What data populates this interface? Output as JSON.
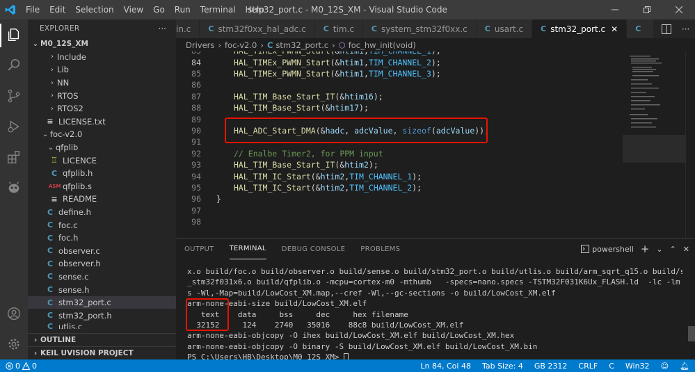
{
  "window": {
    "title": "stm32_port.c - M0_12S_XM - Visual Studio Code",
    "menu": [
      "File",
      "Edit",
      "Selection",
      "View",
      "Go",
      "Run",
      "Terminal",
      "Help"
    ]
  },
  "sidebar": {
    "title": "EXPLORER",
    "more": "···",
    "root": "M0_12S_XM",
    "items": [
      {
        "label": "Include",
        "kind": "folder"
      },
      {
        "label": "Lib",
        "kind": "folder"
      },
      {
        "label": "NN",
        "kind": "folder"
      },
      {
        "label": "RTOS",
        "kind": "folder"
      },
      {
        "label": "RTOS2",
        "kind": "folder"
      },
      {
        "label": "LICENSE.txt",
        "kind": "txt"
      },
      {
        "label": "foc-v2.0",
        "kind": "folder-open"
      },
      {
        "label": "qfplib",
        "kind": "folder-open"
      },
      {
        "label": "LICENCE",
        "kind": "licence"
      },
      {
        "label": "qfplib.h",
        "kind": "c"
      },
      {
        "label": "qfplib.s",
        "kind": "asm"
      },
      {
        "label": "README",
        "kind": "txt"
      },
      {
        "label": "define.h",
        "kind": "c"
      },
      {
        "label": "foc.c",
        "kind": "c"
      },
      {
        "label": "foc.h",
        "kind": "c"
      },
      {
        "label": "observer.c",
        "kind": "c"
      },
      {
        "label": "observer.h",
        "kind": "c"
      },
      {
        "label": "sense.c",
        "kind": "c"
      },
      {
        "label": "sense.h",
        "kind": "c"
      },
      {
        "label": "stm32_port.c",
        "kind": "c"
      },
      {
        "label": "stm32_port.h",
        "kind": "c"
      },
      {
        "label": "utlis.c",
        "kind": "c"
      }
    ],
    "outline": "OUTLINE",
    "keil": "KEIL UVISION PROJECT"
  },
  "tabs": [
    {
      "label": "in.c",
      "active": false
    },
    {
      "label": "stm32f0xx_hal_adc.c",
      "active": false
    },
    {
      "label": "tim.c",
      "active": false
    },
    {
      "label": "system_stm32f0xx.c",
      "active": false
    },
    {
      "label": "usart.c",
      "active": false
    },
    {
      "label": "stm32_port.c",
      "active": true
    },
    {
      "label": "",
      "active": false
    }
  ],
  "breadcrumb": [
    "Drivers",
    "foc-v2.0",
    "stm32_port.c",
    "foc_hw_init(void)"
  ],
  "editor": {
    "current_line": "84",
    "lines": [
      {
        "n": "83",
        "code": "HAL_TIMEx_PWMN_Start(&htim1,TIM_CHANNEL_1);"
      },
      {
        "n": "84",
        "code": "HAL_TIMEx_PWMN_Start(&htim1,TIM_CHANNEL_2);"
      },
      {
        "n": "85",
        "code": "HAL_TIMEx_PWMN_Start(&htim1,TIM_CHANNEL_3);"
      },
      {
        "n": "86",
        "code": ""
      },
      {
        "n": "87",
        "code": "HAL_TIM_Base_Start_IT(&htim16);"
      },
      {
        "n": "88",
        "code": "HAL_TIM_Base_Start(&htim17);"
      },
      {
        "n": "89",
        "code": ""
      },
      {
        "n": "90",
        "code": "HAL_ADC_Start_DMA(&hadc, adcValue, sizeof(adcValue));"
      },
      {
        "n": "91",
        "code": ""
      },
      {
        "n": "92",
        "code": "// Enalbe Timer2, for PPM input"
      },
      {
        "n": "93",
        "code": "HAL_TIM_Base_Start_IT(&htim2);"
      },
      {
        "n": "94",
        "code": "HAL_TIM_IC_Start(&htim2,TIM_CHANNEL_1);"
      },
      {
        "n": "95",
        "code": "HAL_TIM_IC_Start(&htim2,TIM_CHANNEL_2);"
      },
      {
        "n": "96",
        "code": "}"
      },
      {
        "n": "97",
        "code": ""
      },
      {
        "n": "98",
        "code": ""
      }
    ]
  },
  "panel": {
    "tabs": [
      "OUTPUT",
      "TERMINAL",
      "DEBUG CONSOLE",
      "PROBLEMS"
    ],
    "active_tab": "TERMINAL",
    "shell": "powershell",
    "terminal_lines": [
      "x.o build/foc.o build/observer.o build/sense.o build/stm32_port.o build/utlis.o build/arm_sqrt_q15.o build/startup",
      "_stm32f031x6.o build/qfplib.o -mcpu=cortex-m0 -mthumb   -specs=nano.specs -TSTM32F031K6Ux_FLASH.ld  -lc -lm -lnosy",
      "s -Wl,-Map=build/LowCost_XM.map,--cref -Wl,--gc-sections -o build/LowCost_XM.elf",
      "arm-none-eabi-size build/LowCost_XM.elf",
      "   text    data     bss     dec     hex filename",
      "  32152     124    2740   35016    88c8 build/LowCost_XM.elf",
      "arm-none-eabi-objcopy -O ihex build/LowCost_XM.elf build/LowCost_XM.hex",
      "arm-none-eabi-objcopy -O binary -S build/LowCost_XM.elf build/LowCost_XM.bin"
    ],
    "prompt": "PS C:\\Users\\HB\\Desktop\\M0_12S_XM> "
  },
  "statusbar": {
    "errors": "0",
    "warnings": "0",
    "position": "Ln 84, Col 48",
    "tab_size": "Tab Size: 4",
    "encoding": "GB 2312",
    "eol": "CRLF",
    "language": "C",
    "platform": "Win32"
  },
  "colors": {
    "accent": "#007acc",
    "highlight_box": "#e51400"
  }
}
